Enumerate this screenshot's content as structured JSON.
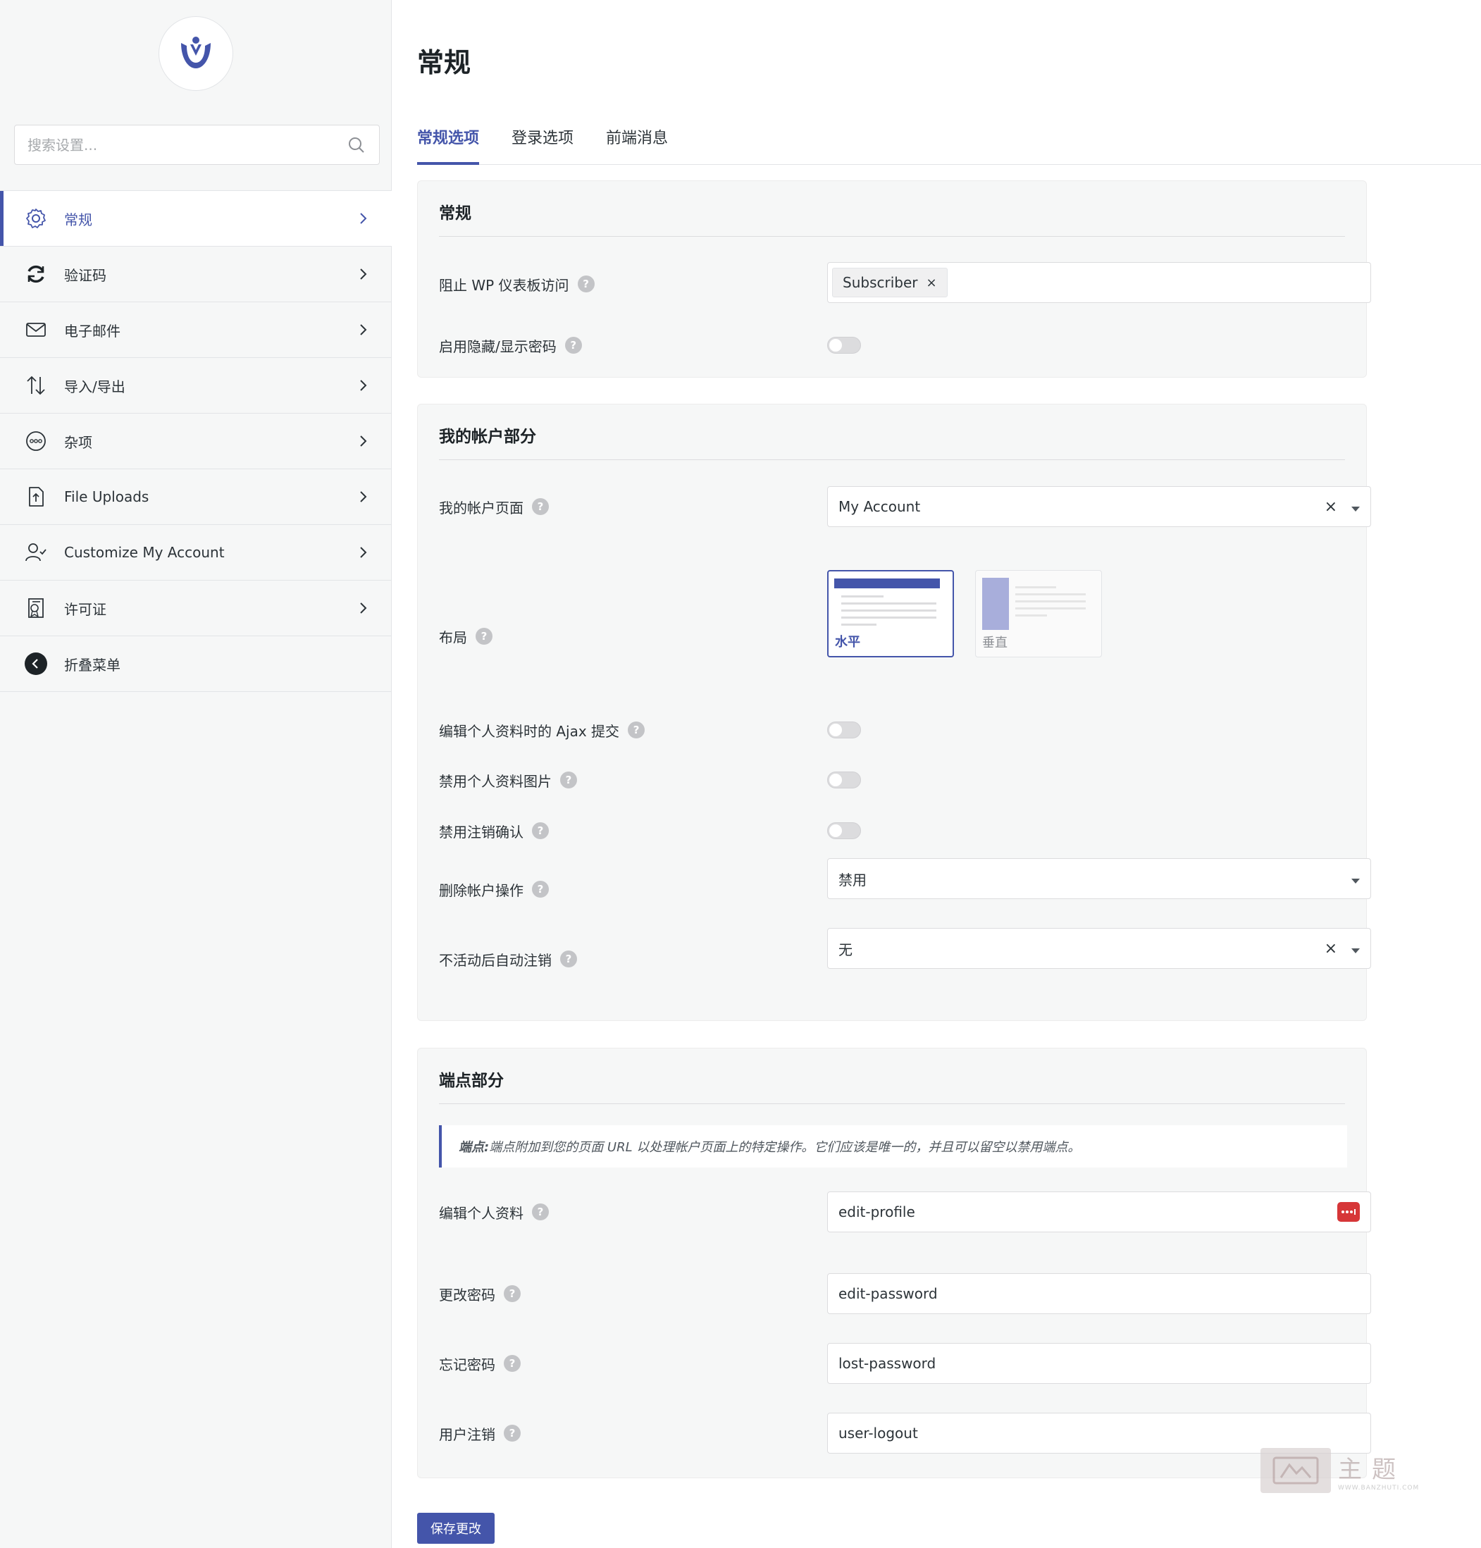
{
  "sidebar": {
    "search_placeholder": "搜索设置...",
    "items": [
      {
        "label": "常规",
        "icon": "gear-icon"
      },
      {
        "label": "验证码",
        "icon": "refresh-icon"
      },
      {
        "label": "电子邮件",
        "icon": "envelope-icon"
      },
      {
        "label": "导入/导出",
        "icon": "arrows-up-down-icon"
      },
      {
        "label": "杂项",
        "icon": "ellipsis-circle-icon"
      },
      {
        "label": "File Uploads",
        "icon": "file-upload-icon"
      },
      {
        "label": "Customize My Account",
        "icon": "user-check-icon"
      },
      {
        "label": "许可证",
        "icon": "license-icon"
      },
      {
        "label": "折叠菜单",
        "icon": "collapse-icon"
      }
    ]
  },
  "page": {
    "title": "常规",
    "tabs": [
      "常规选项",
      "登录选项",
      "前端消息"
    ]
  },
  "general": {
    "title": "常规",
    "block_dashboard_label": "阻止 WP 仪表板访问",
    "block_dashboard_tag": "Subscriber",
    "tag_remove": "×",
    "show_password_label": "启用隐藏/显示密码"
  },
  "account": {
    "title": "我的帐户部分",
    "page_label": "我的帐户页面",
    "page_value": "My Account",
    "clear": "×",
    "layout_label": "布局",
    "layout_horizontal": "水平",
    "layout_vertical": "垂直",
    "ajax_label": "编辑个人资料时的 Ajax 提交",
    "disable_avatar_label": "禁用个人资料图片",
    "disable_logout_confirm_label": "禁用注销确认",
    "delete_action_label": "删除帐户操作",
    "delete_action_value": "禁用",
    "auto_logout_label": "不活动后自动注销",
    "auto_logout_value": "无"
  },
  "endpoints": {
    "title": "端点部分",
    "notice_bold": "端点:",
    "notice_text": " 端点附加到您的页面 URL 以处理帐户页面上的特定操作。它们应该是唯一的，并且可以留空以禁用端点。",
    "edit_profile_label": "编辑个人资料",
    "edit_profile_value": "edit-profile",
    "change_password_label": "更改密码",
    "change_password_value": "edit-password",
    "lost_password_label": "忘记密码",
    "lost_password_value": "lost-password",
    "logout_label": "用户注销",
    "logout_value": "user-logout"
  },
  "help_glyph": "?",
  "save_label": "保存更改",
  "watermark": {
    "main": "主题",
    "sub": "WWW.BANZHUTI.COM"
  },
  "colors": {
    "accent": "#4455aa",
    "danger": "#d63638"
  }
}
